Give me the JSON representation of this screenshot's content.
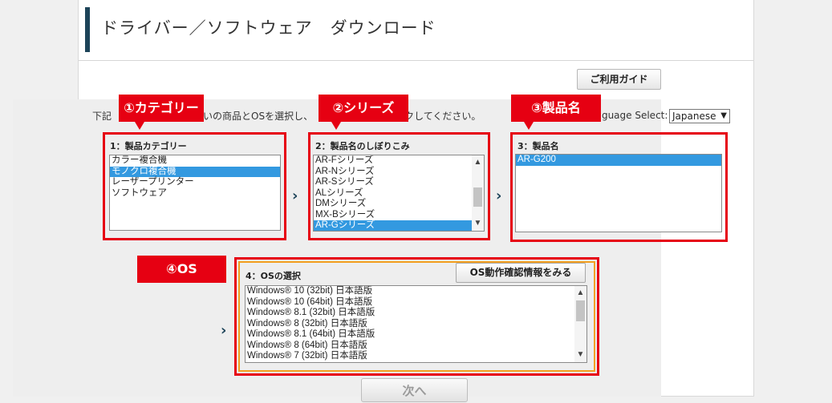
{
  "header": {
    "title": "ドライバー／ソフトウェア　ダウンロード"
  },
  "guide_button": "ご利用ガイド",
  "instruction": {
    "part1": "下記",
    "part2": "いの商品とOSを選択し、",
    "part3": "ックしてください。"
  },
  "language": {
    "label": "anguage Select:",
    "selected": "Japanese"
  },
  "callouts": {
    "category": "①カテゴリー",
    "series": "②シリーズ",
    "product": "③製品名",
    "os": "④OS"
  },
  "step1": {
    "title": "1：製品カテゴリー",
    "options": [
      "カラー複合機",
      "モノクロ複合機",
      "レーザープリンター",
      "ソフトウェア"
    ],
    "selected_index": 1
  },
  "step2": {
    "title": "2：製品名のしぼりこみ",
    "options": [
      "AR-Fシリーズ",
      "AR-Nシリーズ",
      "AR-Sシリーズ",
      "ALシリーズ",
      "DMシリーズ",
      "MX-Bシリーズ",
      "AR-Gシリーズ"
    ],
    "selected_index": 6
  },
  "step3": {
    "title": "3：製品名",
    "options": [
      "AR-G200"
    ],
    "selected_index": 0
  },
  "step4": {
    "title": "4：OSの選択",
    "check_button": "OS動作確認情報をみる",
    "options": [
      "Windows® 10 (32bit) 日本語版",
      "Windows® 10 (64bit) 日本語版",
      "Windows® 8.1 (32bit) 日本語版",
      "Windows® 8 (32bit) 日本語版",
      "Windows® 8.1 (64bit) 日本語版",
      "Windows® 8 (64bit) 日本語版",
      "Windows® 7 (32bit) 日本語版"
    ]
  },
  "next_button": "次へ",
  "colors": {
    "accent_red": "#e60012",
    "header_bar": "#1d4459",
    "selection": "#3399e0",
    "os_border": "#f2a020"
  },
  "icons": {
    "chevron": "chevron-right-icon",
    "scroll_up": "scroll-up-arrow-icon",
    "scroll_down": "scroll-down-arrow-icon"
  }
}
